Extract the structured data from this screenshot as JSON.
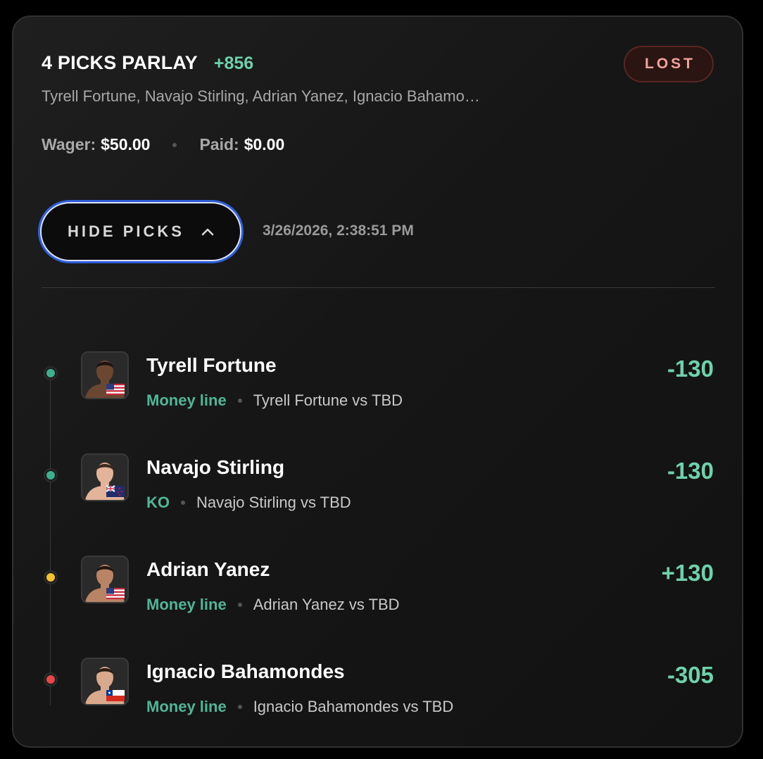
{
  "parlay": {
    "title": "4 PICKS PARLAY",
    "odds": "+856",
    "status": "LOST",
    "subtitle": "Tyrell Fortune, Navajo Stirling, Adrian Yanez, Ignacio Bahamo…",
    "wager_label": "Wager:",
    "wager_value": "$50.00",
    "paid_label": "Paid:",
    "paid_value": "$0.00",
    "toggle_label": "HIDE PICKS",
    "timestamp": "3/26/2026, 2:38:51 PM"
  },
  "colors": {
    "accent_green": "#6ed1ab",
    "status_lost": "#f0a49d",
    "dot_won": "#3fae8c",
    "dot_pending": "#f2c230",
    "dot_lost": "#e84848",
    "focus_ring": "#2e5fd9"
  },
  "picks": [
    {
      "name": "Tyrell Fortune",
      "market": "Money line",
      "matchup": "Tyrell Fortune vs TBD",
      "odds": "-130",
      "result_color": "#3fae8c",
      "flag": "us-flag-icon",
      "skin": "#6b4631",
      "hair": "#1a1210"
    },
    {
      "name": "Navajo Stirling",
      "market": "KO",
      "matchup": "Navajo Stirling vs TBD",
      "odds": "-130",
      "result_color": "#3fae8c",
      "flag": "nz-flag-icon",
      "skin": "#e3b49a",
      "hair": "#3a2a20"
    },
    {
      "name": "Adrian Yanez",
      "market": "Money line",
      "matchup": "Adrian Yanez vs TBD",
      "odds": "+130",
      "result_color": "#f2c230",
      "flag": "us-flag-icon",
      "skin": "#b98466",
      "hair": "#1e1712"
    },
    {
      "name": "Ignacio Bahamondes",
      "market": "Money line",
      "matchup": "Ignacio Bahamondes vs TBD",
      "odds": "-305",
      "result_color": "#e84848",
      "flag": "chile-flag-icon",
      "skin": "#d9a98e",
      "hair": "#2a1d16"
    }
  ]
}
